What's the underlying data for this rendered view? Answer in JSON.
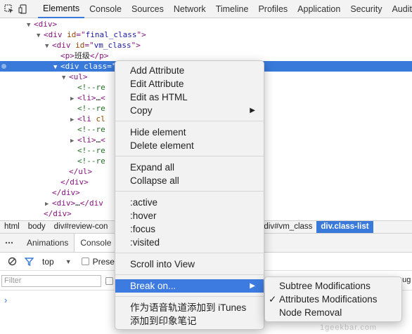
{
  "tabs": [
    "Elements",
    "Console",
    "Sources",
    "Network",
    "Timeline",
    "Profiles",
    "Application",
    "Security",
    "Audits"
  ],
  "tree_lines": [
    {
      "ind": 48,
      "arrow": "▼",
      "parts": [
        [
          "tag",
          "<div>"
        ]
      ]
    },
    {
      "ind": 62,
      "arrow": "▼",
      "parts": [
        [
          "tag",
          "<div "
        ],
        [
          "attr",
          "id"
        ],
        [
          "tag",
          "=\""
        ],
        [
          "val",
          "final_class"
        ],
        [
          "tag",
          "\">"
        ]
      ]
    },
    {
      "ind": 74,
      "arrow": "▼",
      "parts": [
        [
          "tag",
          "<div "
        ],
        [
          "attr",
          "id"
        ],
        [
          "tag",
          "=\""
        ],
        [
          "val",
          "vm_class"
        ],
        [
          "tag",
          "\">"
        ]
      ]
    },
    {
      "ind": 86,
      "arrow": "",
      "parts": [
        [
          "tag",
          "<p>"
        ],
        [
          "txt",
          "班级"
        ],
        [
          "tag",
          "</p>"
        ]
      ]
    },
    {
      "ind": 86,
      "arrow": "▼",
      "sel": true,
      "parts": [
        [
          "tag",
          "<div "
        ],
        [
          "attr",
          "class"
        ],
        [
          "tag",
          "=\"class-list\">"
        ],
        [
          "txt",
          " == $0"
        ]
      ]
    },
    {
      "ind": 98,
      "arrow": "▼",
      "parts": [
        [
          "tag",
          "<ul>"
        ]
      ]
    },
    {
      "ind": 110,
      "arrow": "",
      "parts": [
        [
          "cmt",
          "<!--re"
        ]
      ]
    },
    {
      "ind": 110,
      "arrow": "▶",
      "parts": [
        [
          "tag",
          "<li>"
        ],
        [
          "txt",
          "…"
        ],
        [
          "tag",
          "<"
        ]
      ]
    },
    {
      "ind": 110,
      "arrow": "",
      "parts": [
        [
          "cmt",
          "<!--re"
        ]
      ]
    },
    {
      "ind": 110,
      "arrow": "▶",
      "parts": [
        [
          "tag",
          "<li "
        ],
        [
          "attr",
          "cl"
        ]
      ]
    },
    {
      "ind": 110,
      "arrow": "",
      "parts": [
        [
          "cmt",
          "<!--re"
        ]
      ]
    },
    {
      "ind": 110,
      "arrow": "▶",
      "parts": [
        [
          "tag",
          "<li>"
        ],
        [
          "txt",
          "…"
        ],
        [
          "tag",
          "<"
        ]
      ]
    },
    {
      "ind": 110,
      "arrow": "",
      "parts": [
        [
          "cmt",
          "<!--re"
        ]
      ]
    },
    {
      "ind": 110,
      "arrow": "",
      "parts": [
        [
          "cmt",
          "<!--re"
        ]
      ]
    },
    {
      "ind": 98,
      "arrow": "",
      "parts": [
        [
          "tag",
          "</ul>"
        ]
      ]
    },
    {
      "ind": 86,
      "arrow": "",
      "parts": [
        [
          "tag",
          "</div>"
        ]
      ]
    },
    {
      "ind": 74,
      "arrow": "",
      "parts": [
        [
          "tag",
          "</div>"
        ]
      ]
    },
    {
      "ind": 74,
      "arrow": "▶",
      "parts": [
        [
          "tag",
          "<div>"
        ],
        [
          "txt",
          "…"
        ],
        [
          "tag",
          "</div"
        ]
      ]
    },
    {
      "ind": 62,
      "arrow": "",
      "parts": [
        [
          "tag",
          "</div>"
        ]
      ]
    },
    {
      "ind": 62,
      "arrow": "",
      "parts": [
        [
          "tag",
          "<d"
        ]
      ]
    }
  ],
  "breadcrumbs": [
    "html",
    "body",
    "div#review-con",
    "div#vm_class",
    "div.class-list"
  ],
  "drawer_tabs": [
    "Animations",
    "Console"
  ],
  "console": {
    "context": "top",
    "preserve_log_label": "Prese",
    "filter_placeholder": "Filter",
    "trailing_text": "oug",
    "prompt": "›"
  },
  "context_menu": {
    "groups": [
      [
        {
          "label": "Add Attribute"
        },
        {
          "label": "Edit Attribute"
        },
        {
          "label": "Edit as HTML"
        },
        {
          "label": "Copy",
          "submenu": true
        }
      ],
      [
        {
          "label": "Hide element"
        },
        {
          "label": "Delete element"
        }
      ],
      [
        {
          "label": "Expand all"
        },
        {
          "label": "Collapse all"
        }
      ],
      [
        {
          "label": ":active"
        },
        {
          "label": ":hover"
        },
        {
          "label": ":focus"
        },
        {
          "label": ":visited"
        }
      ],
      [
        {
          "label": "Scroll into View"
        }
      ],
      [
        {
          "label": "Break on...",
          "submenu": true,
          "highlighted": true
        }
      ],
      [
        {
          "label": "作为语音轨道添加到 iTunes"
        },
        {
          "label": "添加到印象笔记"
        }
      ]
    ]
  },
  "break_submenu": [
    {
      "label": "Subtree Modifications",
      "checked": false
    },
    {
      "label": "Attributes Modifications",
      "checked": true
    },
    {
      "label": "Node Removal",
      "checked": false
    }
  ],
  "watermark": "1geekbar.com",
  "colors": {
    "accent": "#3879d9",
    "menu_highlight": "#3d7be0",
    "tag": "#881280",
    "attr": "#994500",
    "value": "#1a1aa6",
    "comment": "#236e25"
  }
}
